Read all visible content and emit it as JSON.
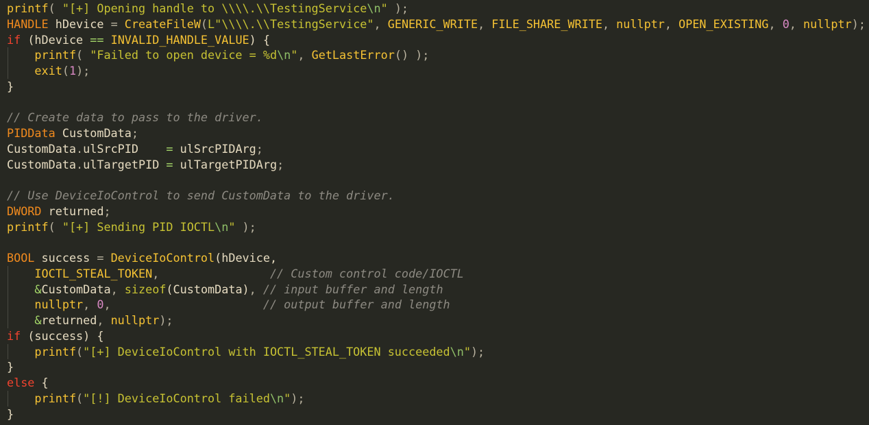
{
  "editor": {
    "background": "#272822",
    "lines": [
      [
        {
          "t": "printf",
          "c": "fn"
        },
        {
          "t": "( ",
          "c": "pn"
        },
        {
          "t": "\"[+] Opening handle to \\\\\\\\.\\\\TestingService",
          "c": "str"
        },
        {
          "t": "\\n",
          "c": "esc"
        },
        {
          "t": "\"",
          "c": "str"
        },
        {
          "t": " );",
          "c": "pn"
        }
      ],
      [
        {
          "t": "HANDLE",
          "c": "ty"
        },
        {
          "t": " hDevice ",
          "c": "id"
        },
        {
          "t": "=",
          "c": "pn"
        },
        {
          "t": " ",
          "c": "id"
        },
        {
          "t": "CreateFileW",
          "c": "fn"
        },
        {
          "t": "(",
          "c": "pn"
        },
        {
          "t": "L\"\\\\\\\\.\\\\TestingService\"",
          "c": "str"
        },
        {
          "t": ", ",
          "c": "pn"
        },
        {
          "t": "GENERIC_WRITE",
          "c": "fn"
        },
        {
          "t": ", ",
          "c": "pn"
        },
        {
          "t": "FILE_SHARE_WRITE",
          "c": "fn"
        },
        {
          "t": ", ",
          "c": "pn"
        },
        {
          "t": "nullptr",
          "c": "fn"
        },
        {
          "t": ", ",
          "c": "pn"
        },
        {
          "t": "OPEN_EXISTING",
          "c": "fn"
        },
        {
          "t": ", ",
          "c": "pn"
        },
        {
          "t": "0",
          "c": "num"
        },
        {
          "t": ", ",
          "c": "pn"
        },
        {
          "t": "nullptr",
          "c": "fn"
        },
        {
          "t": ");",
          "c": "pn"
        }
      ],
      [
        {
          "t": "if",
          "c": "kw"
        },
        {
          "t": " (hDevice ",
          "c": "id"
        },
        {
          "t": "==",
          "c": "op"
        },
        {
          "t": " ",
          "c": "id"
        },
        {
          "t": "INVALID_HANDLE_VALUE",
          "c": "fn"
        },
        {
          "t": ") {",
          "c": "id"
        }
      ],
      [
        {
          "t": "    ",
          "c": "id",
          "guide": true
        },
        {
          "t": "printf",
          "c": "fn"
        },
        {
          "t": "( ",
          "c": "pn"
        },
        {
          "t": "\"Failed to open device = %d",
          "c": "str"
        },
        {
          "t": "\\n",
          "c": "esc"
        },
        {
          "t": "\"",
          "c": "str"
        },
        {
          "t": ", ",
          "c": "pn"
        },
        {
          "t": "GetLastError",
          "c": "fn"
        },
        {
          "t": "() );",
          "c": "pn"
        }
      ],
      [
        {
          "t": "    ",
          "c": "id",
          "guide": true
        },
        {
          "t": "exit",
          "c": "fn"
        },
        {
          "t": "(",
          "c": "pn"
        },
        {
          "t": "1",
          "c": "num"
        },
        {
          "t": ");",
          "c": "pn"
        }
      ],
      [
        {
          "t": "}",
          "c": "id"
        }
      ],
      [],
      [
        {
          "t": "// Create data to pass to the driver.",
          "c": "cm"
        }
      ],
      [
        {
          "t": "PIDData",
          "c": "ty"
        },
        {
          "t": " CustomData",
          "c": "id"
        },
        {
          "t": ";",
          "c": "pn"
        }
      ],
      [
        {
          "t": "CustomData",
          "c": "id"
        },
        {
          "t": ".",
          "c": "pn"
        },
        {
          "t": "ulSrcPID    ",
          "c": "id"
        },
        {
          "t": "=",
          "c": "op"
        },
        {
          "t": " ulSrcPIDArg",
          "c": "id"
        },
        {
          "t": ";",
          "c": "pn"
        }
      ],
      [
        {
          "t": "CustomData",
          "c": "id"
        },
        {
          "t": ".",
          "c": "pn"
        },
        {
          "t": "ulTargetPID ",
          "c": "id"
        },
        {
          "t": "=",
          "c": "op"
        },
        {
          "t": " ulTargetPIDArg",
          "c": "id"
        },
        {
          "t": ";",
          "c": "pn"
        }
      ],
      [],
      [
        {
          "t": "// Use DeviceIoControl to send CustomData to the driver.",
          "c": "cm"
        }
      ],
      [
        {
          "t": "DWORD",
          "c": "ty"
        },
        {
          "t": " returned",
          "c": "id"
        },
        {
          "t": ";",
          "c": "pn"
        }
      ],
      [
        {
          "t": "printf",
          "c": "fn"
        },
        {
          "t": "( ",
          "c": "pn"
        },
        {
          "t": "\"[+] Sending PID IOCTL",
          "c": "str"
        },
        {
          "t": "\\n",
          "c": "esc"
        },
        {
          "t": "\"",
          "c": "str"
        },
        {
          "t": " );",
          "c": "pn"
        }
      ],
      [],
      [
        {
          "t": "BOOL",
          "c": "ty"
        },
        {
          "t": " success ",
          "c": "id"
        },
        {
          "t": "=",
          "c": "pn"
        },
        {
          "t": " ",
          "c": "id"
        },
        {
          "t": "DeviceIoControl",
          "c": "fn"
        },
        {
          "t": "(hDevice,",
          "c": "id"
        }
      ],
      [
        {
          "t": "    ",
          "c": "id",
          "guide": true
        },
        {
          "t": "IOCTL_STEAL_TOKEN",
          "c": "fn"
        },
        {
          "t": ",",
          "c": "pn"
        },
        {
          "t": "                ",
          "c": "id"
        },
        {
          "t": "// Custom control code/IOCTL",
          "c": "cm"
        }
      ],
      [
        {
          "t": "    ",
          "c": "id",
          "guide": true
        },
        {
          "t": "&",
          "c": "op"
        },
        {
          "t": "CustomData",
          "c": "id"
        },
        {
          "t": ", ",
          "c": "pn"
        },
        {
          "t": "sizeof",
          "c": "str"
        },
        {
          "t": "(CustomData)",
          "c": "id"
        },
        {
          "t": ",",
          "c": "pn"
        },
        {
          "t": " ",
          "c": "id"
        },
        {
          "t": "// input buffer and length",
          "c": "cm"
        }
      ],
      [
        {
          "t": "    ",
          "c": "id",
          "guide": true
        },
        {
          "t": "nullptr",
          "c": "fn"
        },
        {
          "t": ", ",
          "c": "pn"
        },
        {
          "t": "0",
          "c": "num"
        },
        {
          "t": ",",
          "c": "pn"
        },
        {
          "t": "                      ",
          "c": "id"
        },
        {
          "t": "// output buffer and length",
          "c": "cm"
        }
      ],
      [
        {
          "t": "    ",
          "c": "id",
          "guide": true
        },
        {
          "t": "&",
          "c": "op"
        },
        {
          "t": "returned",
          "c": "id"
        },
        {
          "t": ", ",
          "c": "pn"
        },
        {
          "t": "nullptr",
          "c": "fn"
        },
        {
          "t": ");",
          "c": "pn"
        }
      ],
      [
        {
          "t": "if",
          "c": "kw"
        },
        {
          "t": " (success) {",
          "c": "id"
        }
      ],
      [
        {
          "t": "    ",
          "c": "id",
          "guide": true
        },
        {
          "t": "printf",
          "c": "fn"
        },
        {
          "t": "(",
          "c": "pn"
        },
        {
          "t": "\"[+] DeviceIoControl with IOCTL_STEAL_TOKEN succeeded",
          "c": "str"
        },
        {
          "t": "\\n",
          "c": "esc"
        },
        {
          "t": "\"",
          "c": "str"
        },
        {
          "t": ");",
          "c": "pn"
        }
      ],
      [
        {
          "t": "}",
          "c": "id"
        }
      ],
      [
        {
          "t": "else",
          "c": "kw"
        },
        {
          "t": " {",
          "c": "id"
        }
      ],
      [
        {
          "t": "    ",
          "c": "id",
          "guide": true
        },
        {
          "t": "printf",
          "c": "fn"
        },
        {
          "t": "(",
          "c": "pn"
        },
        {
          "t": "\"[!] DeviceIoControl failed",
          "c": "str"
        },
        {
          "t": "\\n",
          "c": "esc"
        },
        {
          "t": "\"",
          "c": "str"
        },
        {
          "t": ");",
          "c": "pn"
        }
      ],
      [
        {
          "t": "}",
          "c": "id"
        }
      ]
    ]
  }
}
